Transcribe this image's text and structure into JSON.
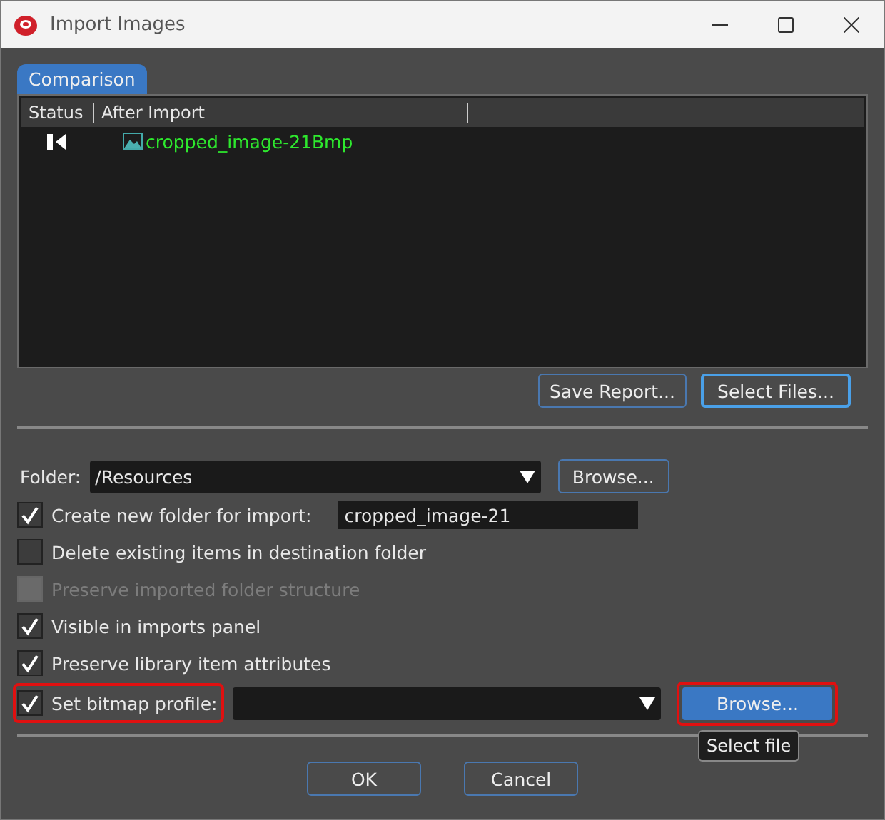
{
  "window": {
    "title": "Import Images"
  },
  "tabs": [
    {
      "label": "Comparison",
      "selected": true
    }
  ],
  "table": {
    "columns": [
      "Status",
      "After Import"
    ],
    "rows": [
      {
        "after_import": "cropped_image-21Bmp"
      }
    ]
  },
  "report_buttons": [
    {
      "label": "Save Report...",
      "focused": false
    },
    {
      "label": "Select Files...",
      "focused": true
    }
  ],
  "folder": {
    "label": "Folder:",
    "value": "/Resources",
    "browse": "Browse..."
  },
  "options": [
    {
      "kind": "field",
      "label": "Create new folder for import:",
      "checked": true,
      "disabled": false,
      "highlighted": false,
      "value": "cropped_image-21"
    },
    {
      "kind": "plain",
      "label": "Delete existing items in destination folder",
      "checked": false,
      "disabled": false,
      "highlighted": false
    },
    {
      "kind": "plain",
      "label": "Preserve imported folder structure",
      "checked": false,
      "disabled": true,
      "highlighted": false
    },
    {
      "kind": "plain",
      "label": "Visible in imports panel",
      "checked": true,
      "disabled": false,
      "highlighted": false
    },
    {
      "kind": "plain",
      "label": "Preserve library item attributes",
      "checked": true,
      "disabled": false,
      "highlighted": false
    },
    {
      "kind": "profile",
      "label": "Set bitmap profile:",
      "checked": true,
      "disabled": false,
      "highlighted": true,
      "browse": "Browse...",
      "browse_highlighted": true
    }
  ],
  "tooltip": "Select file",
  "buttons": [
    "OK",
    "Cancel"
  ]
}
